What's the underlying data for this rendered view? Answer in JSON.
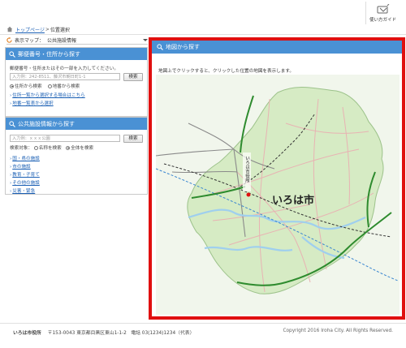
{
  "header": {
    "guide_label": "使い方ガイド"
  },
  "breadcrumb": {
    "home_label": "トップページ",
    "separator": ">",
    "current": "位置選択"
  },
  "map_select": {
    "label": "表示マップ：",
    "value": "公共施設情報"
  },
  "address_panel": {
    "title": "郵便番号・住所から探す",
    "instruction": "郵便番号・住所またはその一部を入力してください。",
    "placeholder": "入力例：242-8511、藤沢市朝日町1-1",
    "search_button": "検索",
    "radio_address": "住所から検索",
    "radio_landmark": "地番から検索",
    "link_list": "住所一覧から選択する場合はこちら",
    "link_landmark": "地番一覧表から選択"
  },
  "facility_panel": {
    "title": "公共施設情報から探す",
    "placeholder": "入力例：ｘｘｘ公園",
    "search_button": "検索",
    "target_label": "検索対象：",
    "radio_name": "名称を検索",
    "radio_all": "全体を検索",
    "links": [
      "国・県の施設",
      "市の施設",
      "教育・子育て",
      "その他の施設",
      "災害・緊急"
    ]
  },
  "map_panel": {
    "title": "地図から探す",
    "instruction": "地図上でクリックすると、クリックした位置の地図を表示します。",
    "city_name": "いろは市",
    "city_hall_label": "いろは市役所"
  },
  "footer": {
    "org": "いろは市役所",
    "address": "〒153-0043 東京都目黒区東山1-1-2",
    "phone": "電話 03(1234)1234（代表）",
    "copyright": "Copyright 2016 Iroha City. All Rights Reserved."
  },
  "colors": {
    "header_blue": "#4a91d4",
    "highlight_red": "#e01010",
    "link_blue": "#1a5fb4",
    "map_green": "#d6ebc4"
  }
}
